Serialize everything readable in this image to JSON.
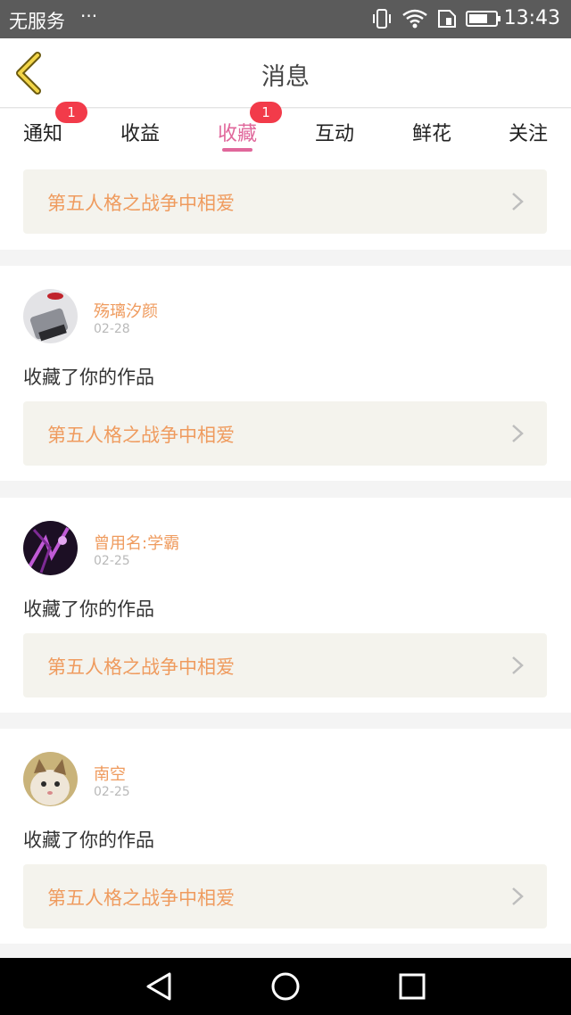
{
  "status_bar": {
    "carrier": "无服务",
    "dots": "···",
    "time": "13:43",
    "icons": [
      "vibrate-icon",
      "wifi-icon",
      "sim-icon",
      "battery-icon"
    ]
  },
  "header": {
    "title": "消息",
    "back_icon": "chevron-left-icon"
  },
  "tabs": [
    {
      "label": "通知",
      "badge": "1"
    },
    {
      "label": "收益"
    },
    {
      "label": "收藏",
      "badge": "1",
      "active": true
    },
    {
      "label": "互动"
    },
    {
      "label": "鲜花"
    },
    {
      "label": "关注"
    }
  ],
  "first_card": {
    "work_title": "第五人格之战争中相爱"
  },
  "items": [
    {
      "name": "殇璃汐颜",
      "date": "02-28",
      "action": "收藏了你的作品",
      "work_title": "第五人格之战争中相爱"
    },
    {
      "name": "曾用名:学霸",
      "date": "02-25",
      "action": "收藏了你的作品",
      "work_title": "第五人格之战争中相爱"
    },
    {
      "name": "南空",
      "date": "02-25",
      "action": "收藏了你的作品",
      "work_title": "第五人格之战争中相爱"
    }
  ],
  "colors": {
    "accent_pink": "#e0679b",
    "badge_red": "#f23b4a",
    "work_orange": "#ef9b5e",
    "back_yellow": "#f2d548"
  },
  "system_nav": [
    "back-triangle-icon",
    "home-circle-icon",
    "recents-square-icon"
  ]
}
